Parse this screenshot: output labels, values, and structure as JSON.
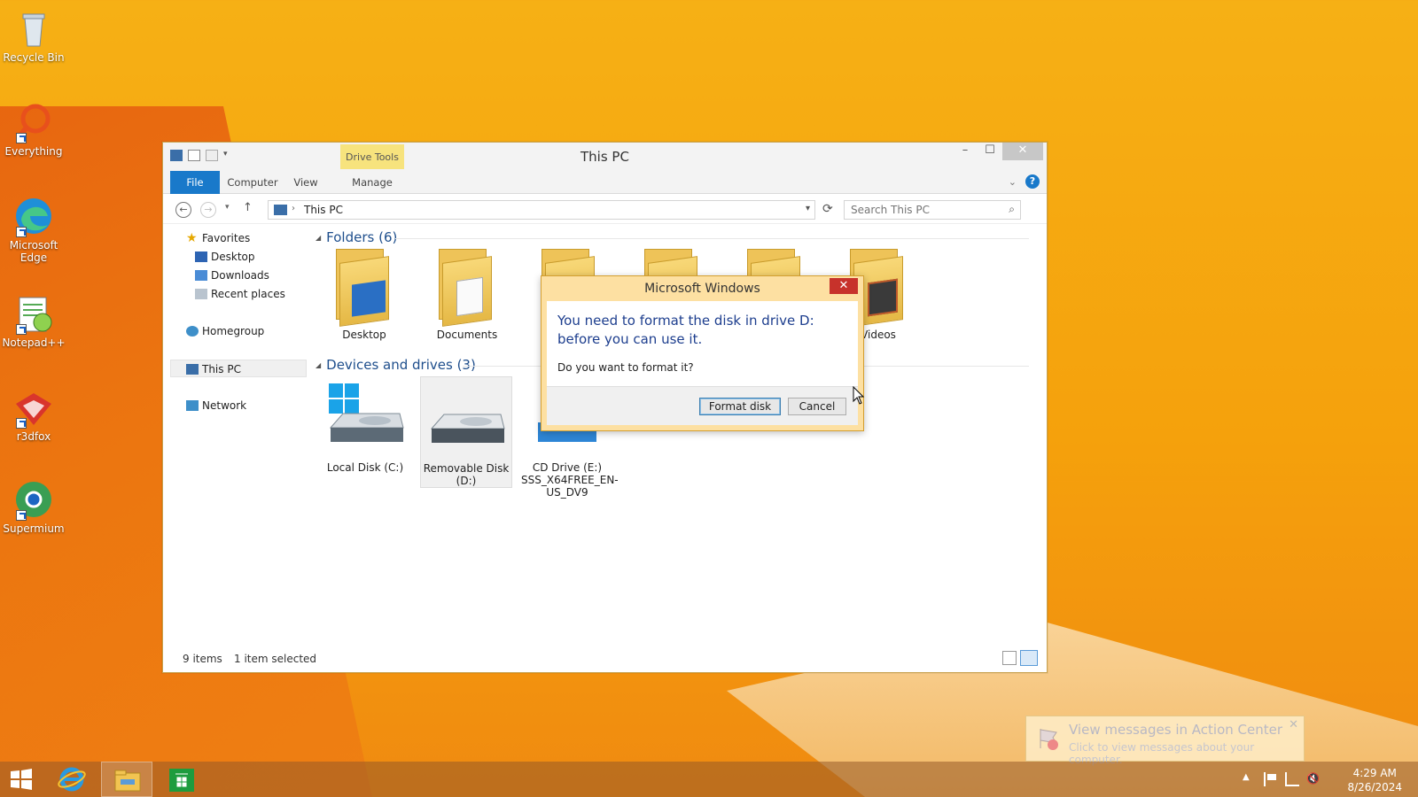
{
  "desktop": {
    "icons": [
      {
        "label": "Recycle Bin",
        "icon": "recycle-bin-icon"
      },
      {
        "label": "Everything",
        "icon": "everything-search-icon"
      },
      {
        "label": "Microsoft Edge",
        "icon": "edge-icon"
      },
      {
        "label": "Notepad++",
        "icon": "notepad-plus-plus-icon"
      },
      {
        "label": "r3dfox",
        "icon": "r3dfox-icon"
      },
      {
        "label": "Supermium",
        "icon": "supermium-icon"
      }
    ]
  },
  "explorer": {
    "title": "This PC",
    "contextual_tab": "Drive Tools",
    "tabs": [
      "File",
      "Computer",
      "View",
      "Manage"
    ],
    "address": "This PC",
    "search_placeholder": "Search This PC",
    "nav": {
      "favorites": "Favorites",
      "desktop": "Desktop",
      "downloads": "Downloads",
      "recent": "Recent places",
      "homegroup": "Homegroup",
      "this_pc": "This PC",
      "network": "Network"
    },
    "folders_header": "Folders (6)",
    "folders": [
      {
        "label": "Desktop"
      },
      {
        "label": "Documents"
      },
      {
        "label": "Videos"
      }
    ],
    "drives_header": "Devices and drives (3)",
    "drives": [
      {
        "label": "Local Disk (C:)"
      },
      {
        "label": "Removable Disk (D:)"
      },
      {
        "label": "CD Drive (E:) SSS_X64FREE_EN-US_DV9"
      }
    ],
    "status": {
      "items": "9 items",
      "selected": "1 item selected"
    }
  },
  "dialog": {
    "title": "Microsoft Windows",
    "message": "You need to format the disk in drive D: before you can use it.",
    "question": "Do you want to format it?",
    "format_label": "Format disk",
    "cancel_label": "Cancel"
  },
  "toast": {
    "title": "View messages in Action Center",
    "subtitle": "Click to view messages about your computer."
  },
  "taskbar": {
    "time": "4:29 AM",
    "date": "8/26/2024"
  },
  "colors": {
    "accent": "#1979ca",
    "wallpaper": "#f5a10c",
    "dialog_frame": "#fde0a2",
    "close_red": "#c7322b"
  }
}
